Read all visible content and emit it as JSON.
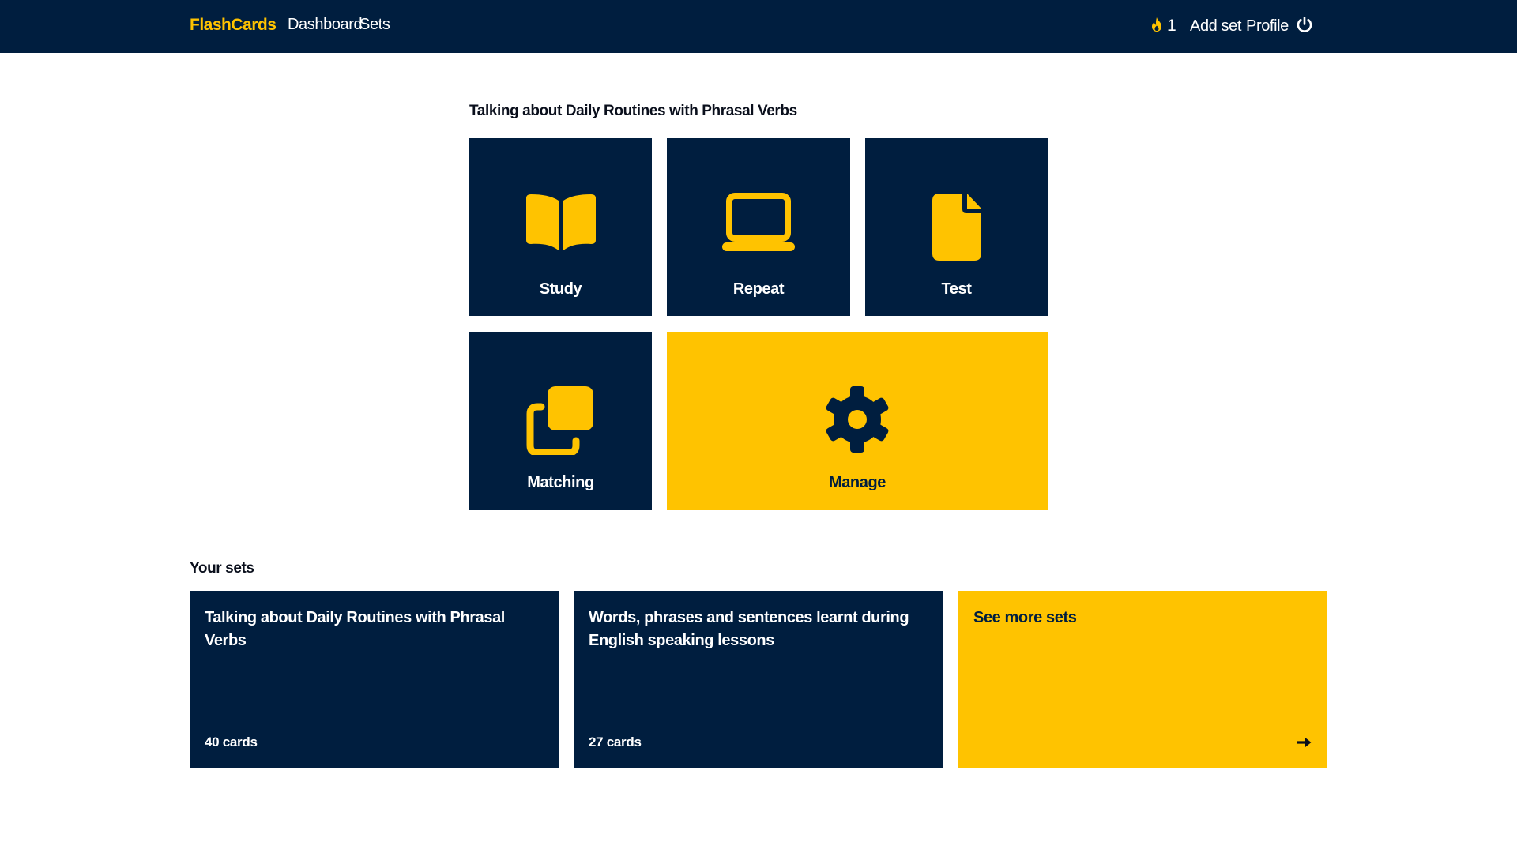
{
  "navbar": {
    "brand": "FlashCards",
    "links": {
      "dashboard": "Dashboard",
      "sets": "Sets"
    },
    "streak": {
      "icon": "flame-icon",
      "count": "1"
    },
    "add_set": "Add set",
    "profile": "Profile",
    "logout_icon": "power-icon"
  },
  "current_set": {
    "title": "Talking about Daily Routines with Phrasal Verbs",
    "modes": {
      "study": {
        "label": "Study",
        "icon": "open-book-icon"
      },
      "repeat": {
        "label": "Repeat",
        "icon": "laptop-icon"
      },
      "test": {
        "label": "Test",
        "icon": "file-icon"
      },
      "matching": {
        "label": "Matching",
        "icon": "clone-icon"
      },
      "manage": {
        "label": "Manage",
        "icon": "gear-icon"
      }
    }
  },
  "your_sets": {
    "title": "Your sets",
    "cards": [
      {
        "title": "Talking about Daily Routines with Phrasal Verbs",
        "count": "40 cards"
      },
      {
        "title": "Words, phrases and sentences learnt during English speaking lessons",
        "count": "27 cards"
      }
    ],
    "see_more": {
      "label": "See more sets",
      "icon": "arrow-right-icon"
    }
  },
  "colors": {
    "navy": "#001e3f",
    "yellow": "#ffc300",
    "white": "#ffffff"
  }
}
